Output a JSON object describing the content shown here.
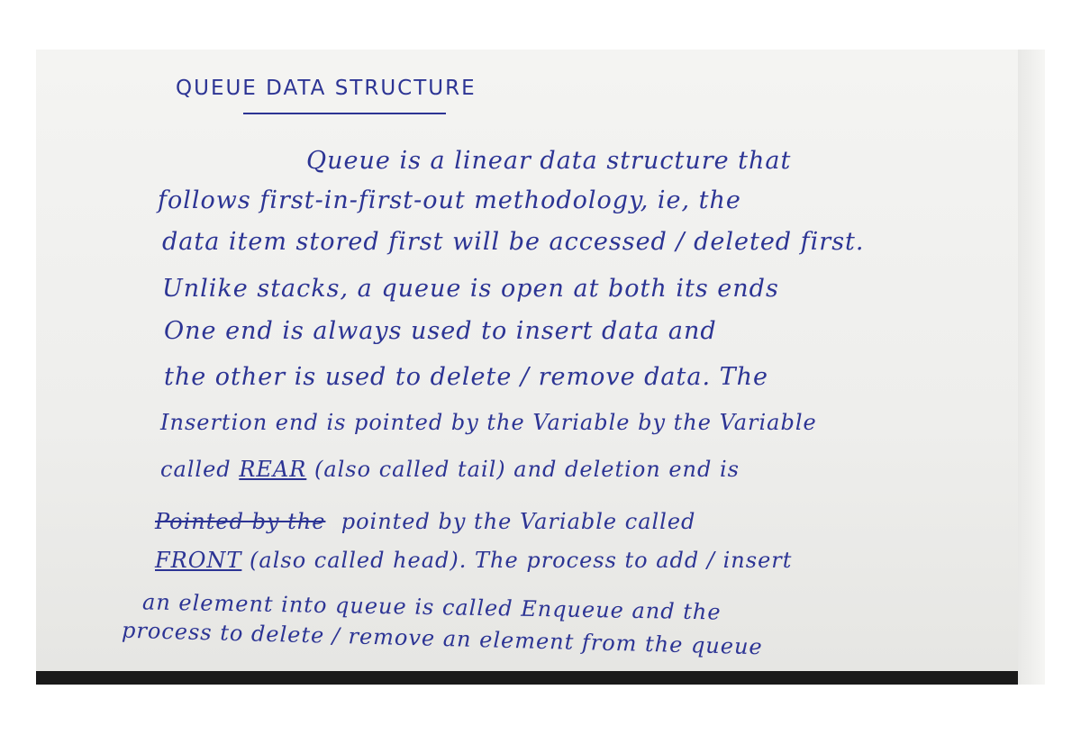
{
  "document": {
    "title": "QUEUE DATA STRUCTURE",
    "lines": [
      "Queue is a linear data structure that",
      "follows first-in-first-out methodology, ie, the",
      "data item stored first will be accessed / deleted first.",
      "Unlike stacks, a queue is open at both its ends",
      "One end is always used to insert data and",
      "the other is used to delete / remove data. The",
      "Insertion end is pointed by the Variable by the Variable",
      "called",
      "REAR",
      "(also called tail) and deletion end is",
      "Pointed by the",
      "pointed by the Variable called",
      "FRONT",
      "(also called head). The process to add / insert",
      "an element into queue is called Enqueue and the",
      "process to delete / remove an element from the queue"
    ],
    "ink_color": "#2c3494",
    "paper_color": "#f0f0ee"
  }
}
